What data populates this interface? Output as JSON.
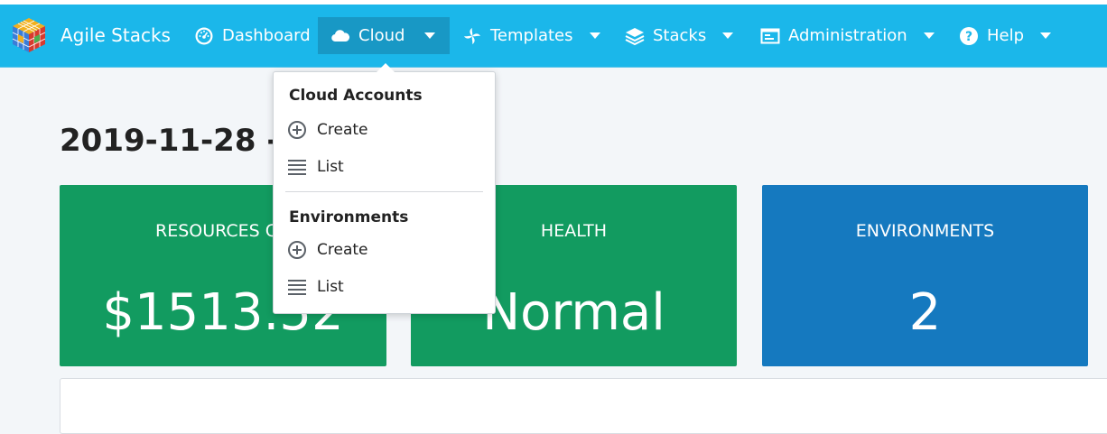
{
  "navbar": {
    "brand": "Agile Stacks",
    "items": [
      {
        "label": "Dashboard",
        "icon": "dashboard-icon"
      },
      {
        "label": "Cloud",
        "icon": "cloud-icon"
      },
      {
        "label": "Templates",
        "icon": "templates-icon"
      },
      {
        "label": "Stacks",
        "icon": "stacks-icon"
      },
      {
        "label": "Administration",
        "icon": "administration-icon"
      },
      {
        "label": "Help",
        "icon": "help-icon"
      }
    ],
    "active_item": "Cloud"
  },
  "cloud_menu": {
    "sections": [
      {
        "header": "Cloud Accounts",
        "items": [
          {
            "label": "Create",
            "icon": "plus-circle-icon"
          },
          {
            "label": "List",
            "icon": "list-icon"
          }
        ]
      },
      {
        "header": "Environments",
        "items": [
          {
            "label": "Create",
            "icon": "plus-circle-icon"
          },
          {
            "label": "List",
            "icon": "list-icon"
          }
        ]
      }
    ]
  },
  "main": {
    "date_range": "2019-11-28 - 2",
    "cards": [
      {
        "title": "RESOURCES CO",
        "value": "$1513.52",
        "color": "#129b60"
      },
      {
        "title": "HEALTH",
        "value": "Normal",
        "color": "#129b60"
      },
      {
        "title": "ENVIRONMENTS",
        "value": "2",
        "color": "#1579bf"
      }
    ]
  },
  "colors": {
    "navbar": "#1bb7ea",
    "active_nav": "#1898c5"
  }
}
